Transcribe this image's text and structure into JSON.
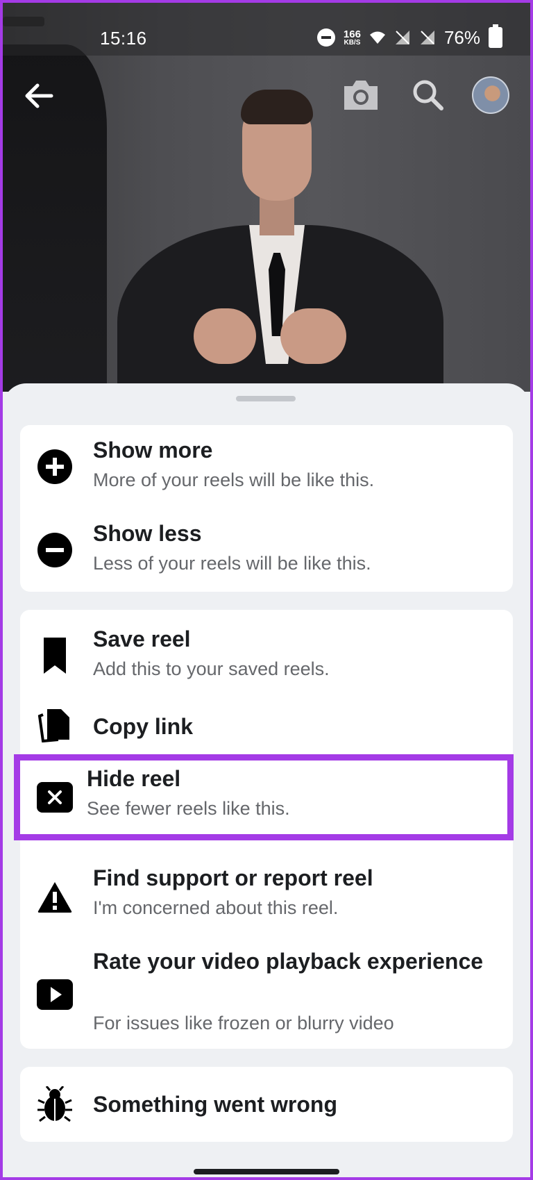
{
  "status_bar": {
    "time": "15:16",
    "network_speed_value": "166",
    "network_speed_unit": "KB/S",
    "battery": "76%"
  },
  "top_bar": {
    "icons": [
      "back-arrow-icon",
      "camera-icon",
      "search-icon",
      "avatar"
    ]
  },
  "menu": {
    "group1": [
      {
        "icon": "plus-circle-icon",
        "title": "Show more",
        "subtitle": "More of your reels will be like this."
      },
      {
        "icon": "minus-circle-icon",
        "title": "Show less",
        "subtitle": "Less of your reels will be like this."
      }
    ],
    "group2": [
      {
        "icon": "bookmark-icon",
        "title": "Save reel",
        "subtitle": "Add this to your saved reels."
      },
      {
        "icon": "copy-icon",
        "title": "Copy link"
      },
      {
        "icon": "close-box-icon",
        "title": "Hide reel",
        "subtitle": "See fewer reels like this.",
        "highlighted": true
      },
      {
        "icon": "warning-icon",
        "title": "Find support or report reel",
        "subtitle": "I'm concerned about this reel."
      },
      {
        "icon": "play-icon",
        "title": "Rate your video playback experience",
        "subtitle": "For issues like frozen or blurry video"
      }
    ],
    "group3": [
      {
        "icon": "bug-icon",
        "title": "Something went wrong"
      }
    ]
  },
  "colors": {
    "highlight": "#a43be6",
    "text_primary": "#1c1e21",
    "text_secondary": "#65676b",
    "sheet_bg": "#eef0f3"
  }
}
